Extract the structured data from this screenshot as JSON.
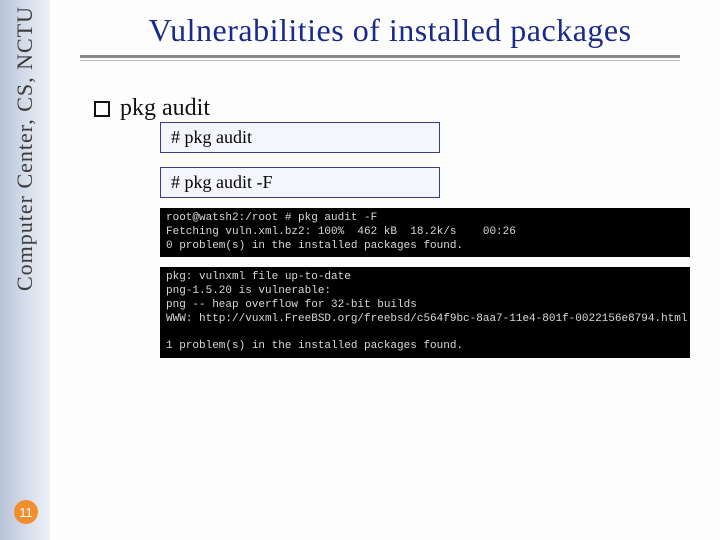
{
  "sidebar": {
    "label": "Computer Center, CS, NCTU"
  },
  "page_number": "11",
  "title": "Vulnerabilities of installed packages",
  "bullet": {
    "label": "pkg audit"
  },
  "commands": {
    "cmd1": "# pkg audit",
    "cmd2": "# pkg audit -F"
  },
  "terminal": {
    "block1_line1": "root@watsh2:/root # pkg audit -F",
    "block1_line2": "Fetching vuln.xml.bz2: 100%  462 kB  18.2k/s    00:26",
    "block1_line3": "0 problem(s) in the installed packages found.",
    "block2_line1": "pkg: vulnxml file up-to-date",
    "block2_line2": "png-1.5.20 is vulnerable:",
    "block2_line3": "png -- heap overflow for 32-bit builds",
    "block2_line4": "WWW: http://vuxml.FreeBSD.org/freebsd/c564f9bc-8aa7-11e4-801f-0022156e8794.html",
    "block2_line5": "",
    "block2_line6": "1 problem(s) in the installed packages found."
  }
}
